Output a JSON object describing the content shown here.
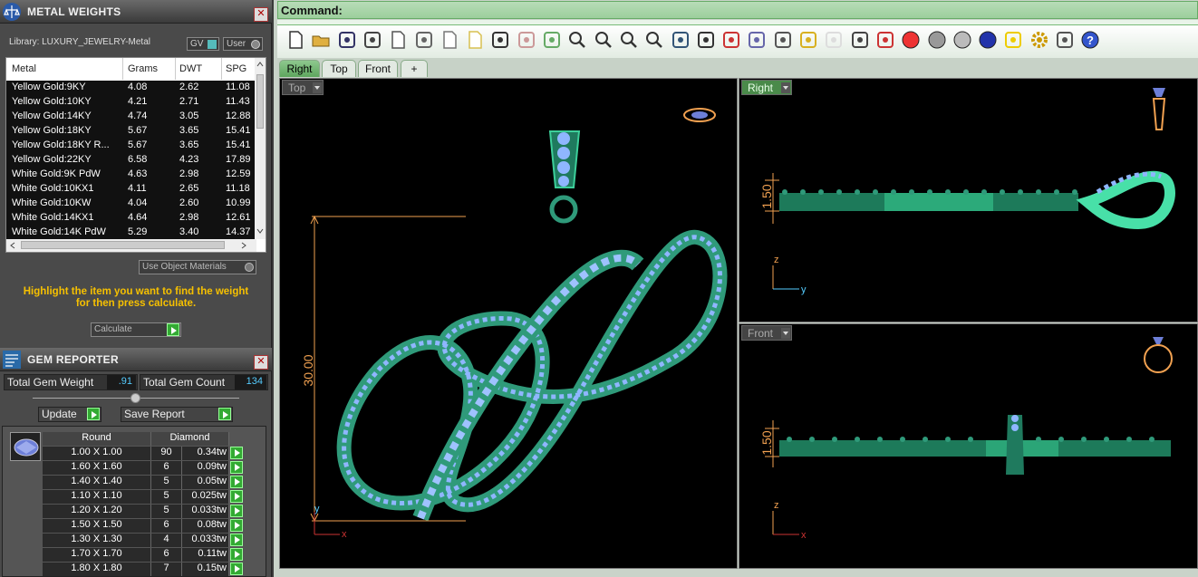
{
  "metal_panel": {
    "title": "METAL WEIGHTS",
    "close": "✕",
    "library_label": "Library: LUXURY_JEWELRY-Metal",
    "gv_label": "GV",
    "user_label": "User",
    "columns": [
      "Metal",
      "Grams",
      "DWT",
      "SPG"
    ],
    "rows": [
      {
        "metal": "Yellow Gold:9KY",
        "grams": "4.08",
        "dwt": "2.62",
        "spg": "11.08"
      },
      {
        "metal": "Yellow Gold:10KY",
        "grams": "4.21",
        "dwt": "2.71",
        "spg": "11.43"
      },
      {
        "metal": "Yellow Gold:14KY",
        "grams": "4.74",
        "dwt": "3.05",
        "spg": "12.88"
      },
      {
        "metal": "Yellow Gold:18KY",
        "grams": "5.67",
        "dwt": "3.65",
        "spg": "15.41"
      },
      {
        "metal": "Yellow Gold:18KY R...",
        "grams": "5.67",
        "dwt": "3.65",
        "spg": "15.41"
      },
      {
        "metal": "Yellow Gold:22KY",
        "grams": "6.58",
        "dwt": "4.23",
        "spg": "17.89"
      },
      {
        "metal": "White Gold:9K PdW",
        "grams": "4.63",
        "dwt": "2.98",
        "spg": "12.59"
      },
      {
        "metal": "White Gold:10KX1",
        "grams": "4.11",
        "dwt": "2.65",
        "spg": "11.18"
      },
      {
        "metal": "White Gold:10KW",
        "grams": "4.04",
        "dwt": "2.60",
        "spg": "10.99"
      },
      {
        "metal": "White Gold:14KX1",
        "grams": "4.64",
        "dwt": "2.98",
        "spg": "12.61"
      },
      {
        "metal": "White Gold:14K PdW",
        "grams": "5.29",
        "dwt": "3.40",
        "spg": "14.37"
      }
    ],
    "use_object_materials": "Use Object Materials",
    "hint_line1": "Highlight the item you want to find the weight",
    "hint_line2": "for then press calculate.",
    "calculate_label": "Calculate"
  },
  "gem_panel": {
    "title": "GEM REPORTER",
    "close": "✕",
    "total_weight_label": "Total Gem Weight",
    "total_weight_value": ".91",
    "total_count_label": "Total Gem Count",
    "total_count_value": "134",
    "update_label": "Update",
    "save_report_label": "Save Report",
    "col_shape": "Round",
    "col_type": "Diamond",
    "rows": [
      {
        "size": "1.00 X 1.00",
        "count": "90",
        "tw": "0.34tw"
      },
      {
        "size": "1.60 X 1.60",
        "count": "6",
        "tw": "0.09tw"
      },
      {
        "size": "1.40 X 1.40",
        "count": "5",
        "tw": "0.05tw"
      },
      {
        "size": "1.10 X 1.10",
        "count": "5",
        "tw": "0.025tw"
      },
      {
        "size": "1.20 X 1.20",
        "count": "5",
        "tw": "0.033tw"
      },
      {
        "size": "1.50 X 1.50",
        "count": "6",
        "tw": "0.08tw"
      },
      {
        "size": "1.30 X 1.30",
        "count": "4",
        "tw": "0.033tw"
      },
      {
        "size": "1.70 X 1.70",
        "count": "6",
        "tw": "0.11tw"
      },
      {
        "size": "1.80 X 1.80",
        "count": "7",
        "tw": "0.15tw"
      }
    ]
  },
  "command": {
    "label": "Command:"
  },
  "toolbar_icons": [
    "new-icon",
    "open-icon",
    "save-icon",
    "print-icon",
    "export-icon",
    "cut-icon",
    "copy-icon",
    "paste-icon",
    "undo-icon",
    "pan-icon",
    "move-icon",
    "zoom-icon",
    "zoom-window-icon",
    "zoom-extents-icon",
    "zoom-selected-icon",
    "rotate-view-icon",
    "four-view-icon",
    "car-icon",
    "plane-icon",
    "clock-icon",
    "grid-snap-icon",
    "light-icon",
    "lock-icon",
    "layer-icon",
    "color-wheel-icon",
    "sphere-grey-icon",
    "sphere-white-icon",
    "sphere-blue-icon",
    "light-cone-icon",
    "gear-icon",
    "selection-icon",
    "help-icon"
  ],
  "tabs": [
    {
      "label": "Right",
      "active": true
    },
    {
      "label": "Top",
      "active": false
    },
    {
      "label": "Front",
      "active": false
    },
    {
      "label": "+",
      "active": false
    }
  ],
  "viewports": {
    "top": {
      "label": "Top",
      "dimension": "30.00",
      "axis_y": "y",
      "axis_x": "x"
    },
    "right": {
      "label": "Right",
      "dimension": "1.50",
      "axis_z": "z",
      "axis_y": "y"
    },
    "front": {
      "label": "Front",
      "dimension": "1.50",
      "axis_z": "z",
      "axis_x": "x"
    }
  },
  "colors": {
    "accent_green": "#5ea65e",
    "hint_yellow": "#f6c000",
    "gem_blue": "#8fb6ff",
    "metal_green": "#2f9a7a",
    "dim_orange": "#f0a050"
  }
}
